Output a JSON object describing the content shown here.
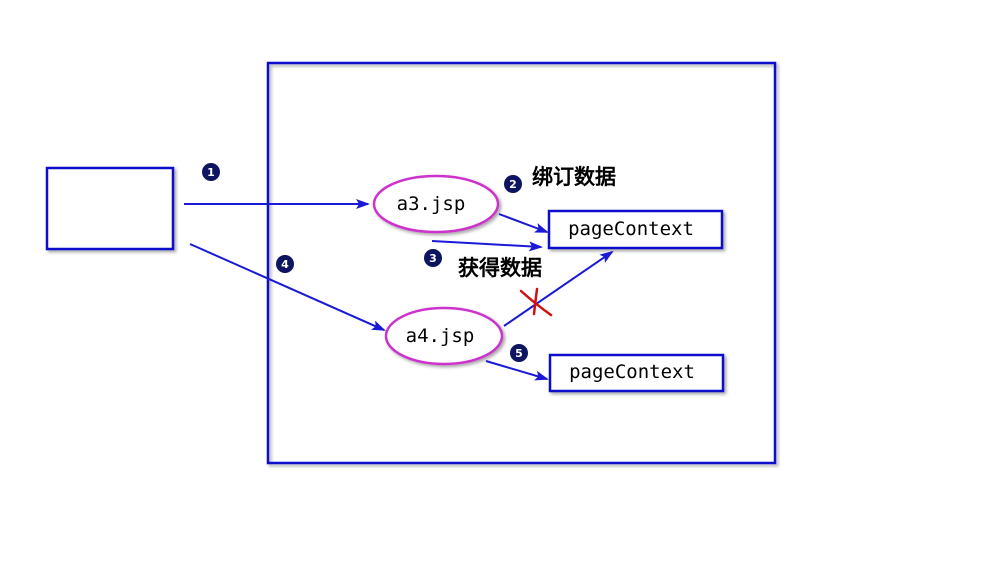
{
  "diagram": {
    "colors": {
      "box_stroke": "#1010cc",
      "arrow": "#1a1ad6",
      "ellipse_stroke": "#cc33cc",
      "badge_fill": "#0d1460",
      "badge_text": "#ffffff",
      "cross": "#d01010",
      "text": "#000000"
    },
    "nodes": {
      "a3_label": "a3.jsp",
      "a4_label": "a4.jsp",
      "page_context_1_label": "pageContext",
      "page_context_2_label": "pageContext"
    },
    "annotations": {
      "bind_data": "绑订数据",
      "get_data": "获得数据"
    },
    "steps": [
      "1",
      "2",
      "3",
      "4",
      "5"
    ]
  }
}
